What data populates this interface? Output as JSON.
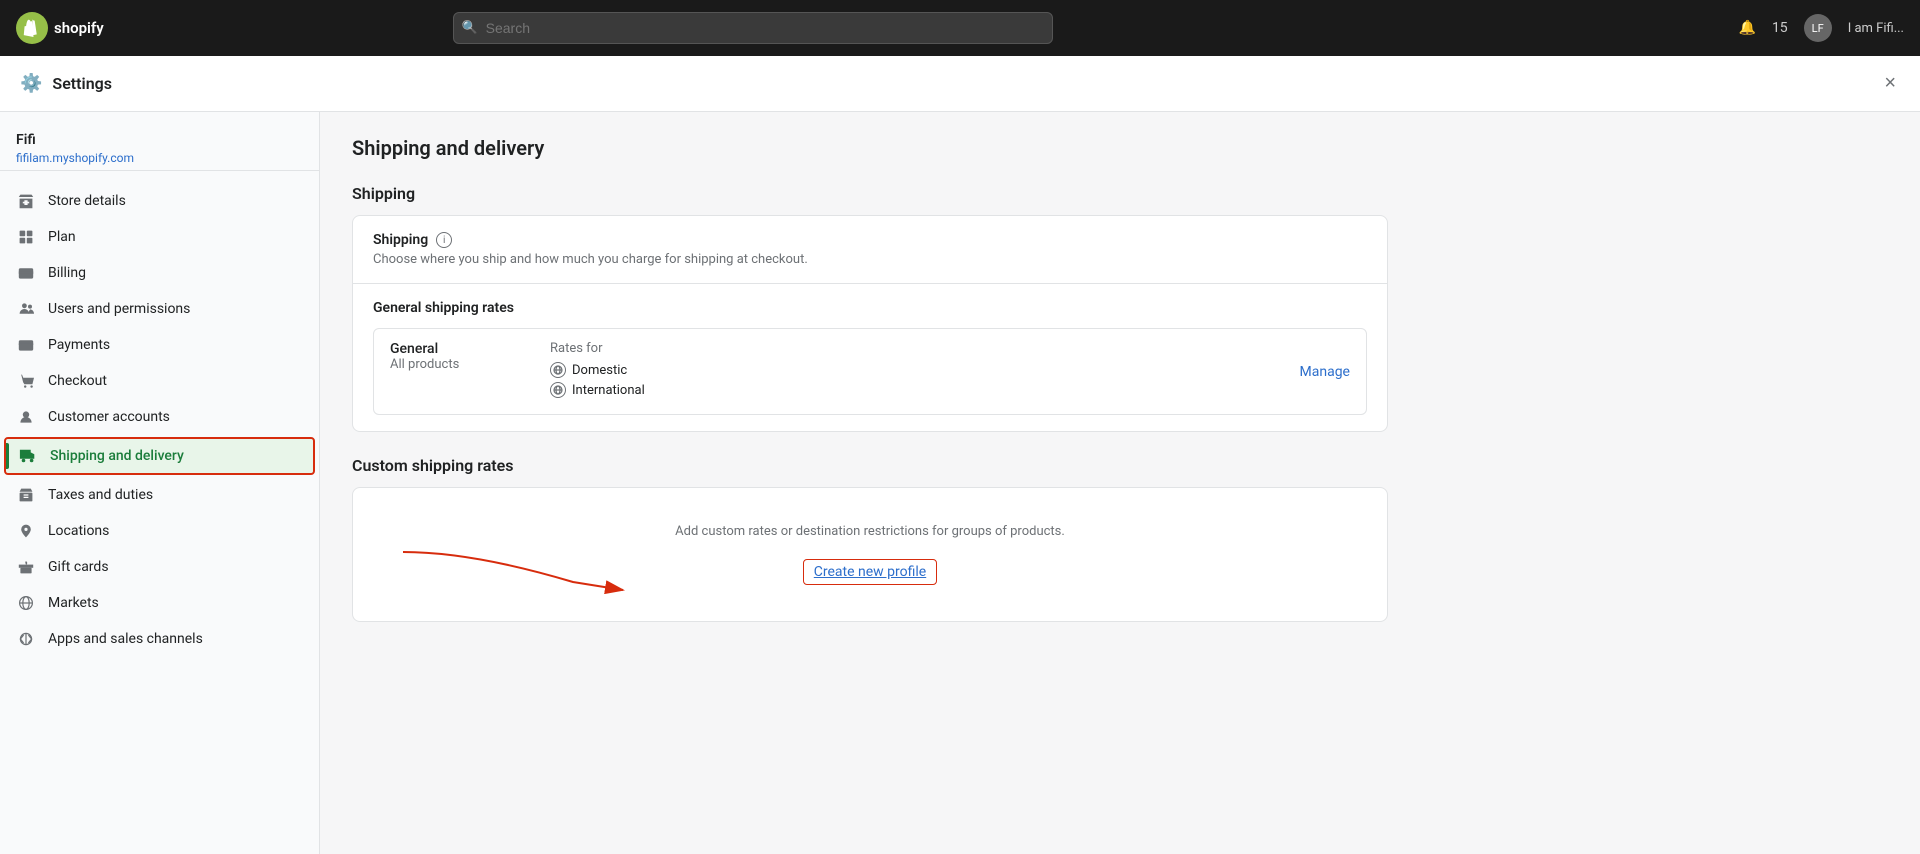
{
  "topbar": {
    "logo_text": "S",
    "brand": "shopify",
    "search_placeholder": "Search",
    "notification_icon": "🔔",
    "user_initials": "LF",
    "username": "I am Fifi..."
  },
  "settings": {
    "title": "Settings",
    "close_label": "×"
  },
  "sidebar": {
    "store_name": "Fifi",
    "store_url": "fifilam.myshopify.com",
    "nav_items": [
      {
        "id": "store-details",
        "icon": "store",
        "label": "Store details"
      },
      {
        "id": "plan",
        "icon": "plan",
        "label": "Plan"
      },
      {
        "id": "billing",
        "icon": "billing",
        "label": "Billing"
      },
      {
        "id": "users-permissions",
        "icon": "users",
        "label": "Users and permissions"
      },
      {
        "id": "payments",
        "icon": "payments",
        "label": "Payments"
      },
      {
        "id": "checkout",
        "icon": "checkout",
        "label": "Checkout"
      },
      {
        "id": "customer-accounts",
        "icon": "customer",
        "label": "Customer accounts"
      },
      {
        "id": "shipping-delivery",
        "icon": "shipping",
        "label": "Shipping and delivery",
        "active": true
      },
      {
        "id": "taxes-duties",
        "icon": "taxes",
        "label": "Taxes and duties"
      },
      {
        "id": "locations",
        "icon": "locations",
        "label": "Locations"
      },
      {
        "id": "gift-cards",
        "icon": "gift",
        "label": "Gift cards"
      },
      {
        "id": "markets",
        "icon": "markets",
        "label": "Markets"
      },
      {
        "id": "apps-sales",
        "icon": "apps",
        "label": "Apps and sales channels"
      }
    ]
  },
  "main": {
    "page_title": "Shipping and delivery",
    "section_shipping_label": "Shipping",
    "shipping_card": {
      "title": "Shipping",
      "description": "Choose where you ship and how much you charge for shipping at checkout.",
      "general_rates_title": "General shipping rates",
      "general_label": "General",
      "all_products_label": "All products",
      "rates_for_label": "Rates for",
      "domestic_label": "Domestic",
      "international_label": "International",
      "manage_label": "Manage"
    },
    "custom_rates": {
      "title": "Custom shipping rates",
      "placeholder_text": "Add custom rates or destination restrictions for groups of products.",
      "create_profile_label": "Create new profile"
    }
  }
}
